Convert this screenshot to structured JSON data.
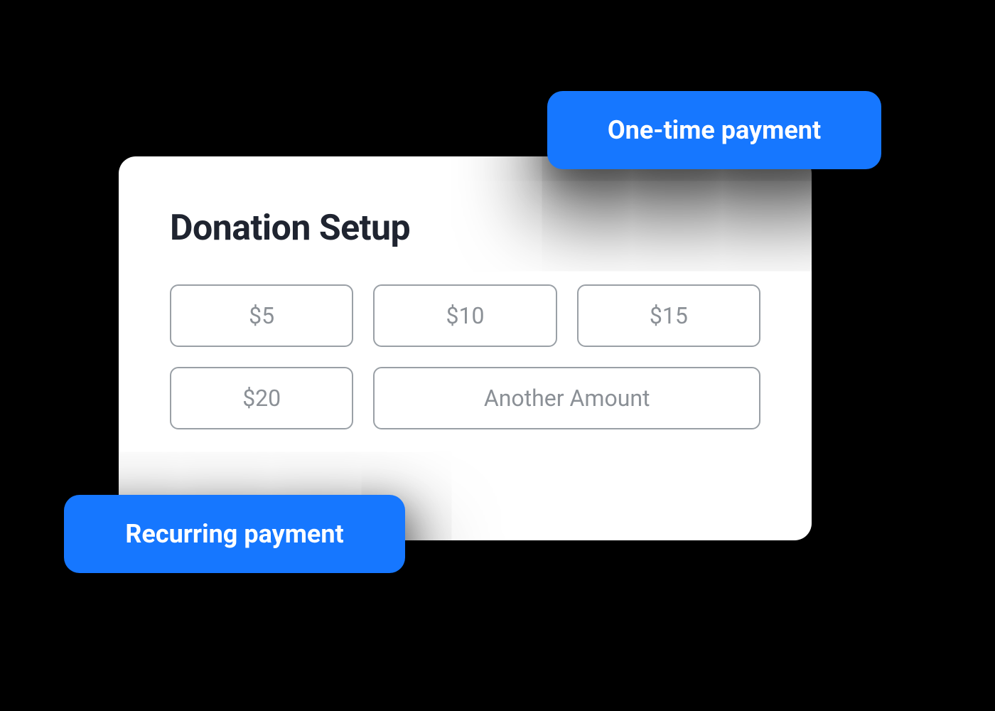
{
  "card": {
    "title": "Donation Setup",
    "amounts": [
      "$5",
      "$10",
      "$15",
      "$20",
      "Another Amount"
    ]
  },
  "badges": {
    "one_time": "One-time payment",
    "recurring": "Recurring payment"
  },
  "colors": {
    "accent": "#1677ff",
    "card_bg": "#ffffff",
    "page_bg": "#000000",
    "btn_border": "#9aa0a6",
    "btn_text": "#8b9096",
    "title_text": "#1f2430"
  }
}
